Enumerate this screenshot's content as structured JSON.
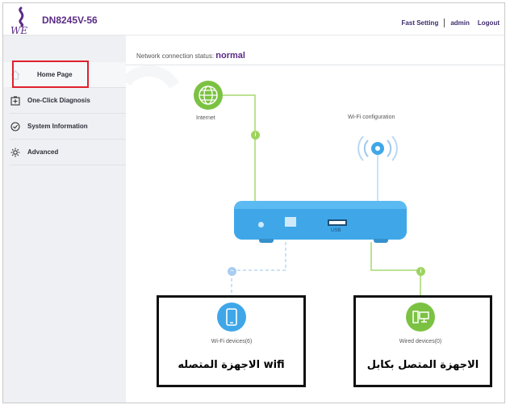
{
  "header": {
    "logo_text": "WE",
    "model": "DN8245V-56",
    "links": {
      "fast_setting": "Fast Setting",
      "admin": "admin",
      "logout": "Logout"
    }
  },
  "sidebar": {
    "items": [
      {
        "label": "Home Page",
        "icon": "home-icon",
        "active": true
      },
      {
        "label": "One-Click Diagnosis",
        "icon": "diagnosis-icon"
      },
      {
        "label": "System Information",
        "icon": "info-check-icon"
      },
      {
        "label": "Advanced",
        "icon": "gear-icon"
      }
    ]
  },
  "main": {
    "status_prefix": "Network connection status:",
    "status_value": "normal",
    "internet_label": "Internet",
    "wifi_config_label": "Wi-Fi configuration",
    "usb_label": "USB",
    "wifi_devices_label": "Wi-Fi devices(6)",
    "wired_devices_label": "Wired devices(0)"
  },
  "annotations": {
    "wifi_caption": "wifi الاجهزة المتصله",
    "wired_caption": "الاجهزة المتصل بكابل"
  },
  "colors": {
    "brand_purple": "#5b2c86",
    "internet_green": "#7cc242",
    "router_blue": "#3fa7e8",
    "highlight_red": "#e0202d"
  }
}
